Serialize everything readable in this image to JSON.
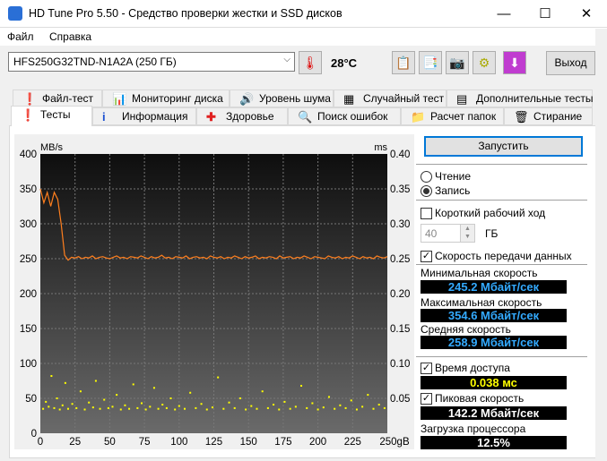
{
  "window": {
    "title": "HD Tune Pro 5.50 - Средство проверки жестки и SSD дисков",
    "minimize": "—",
    "maximize": "☐",
    "close": "✕"
  },
  "menu": [
    "Файл",
    "Справка"
  ],
  "toolbar": {
    "drive": "HFS250G32TND-N1A2A (250 ГБ)",
    "temperature": "28°C",
    "exit": "Выход"
  },
  "tabs_top": [
    {
      "label": "Файл-тест",
      "icon": "file-test-icon"
    },
    {
      "label": "Мониторинг диска",
      "icon": "monitor-icon"
    },
    {
      "label": "Уровень шума",
      "icon": "speaker-icon"
    },
    {
      "label": "Случайный тест",
      "icon": "random-icon"
    },
    {
      "label": "Дополнительные тесты",
      "icon": "extra-tests-icon"
    }
  ],
  "tabs_bottom": [
    {
      "label": "Тесты",
      "icon": "exclamation-icon",
      "active": true
    },
    {
      "label": "Информация",
      "icon": "info-icon"
    },
    {
      "label": "Здоровье",
      "icon": "health-cross-icon"
    },
    {
      "label": "Поиск ошибок",
      "icon": "magnifier-icon"
    },
    {
      "label": "Расчет папок",
      "icon": "folder-icon"
    },
    {
      "label": "Стирание",
      "icon": "trash-icon"
    }
  ],
  "side": {
    "start": "Запустить",
    "read": "Чтение",
    "write": "Запись",
    "mode": "write",
    "short_stroke": "Короткий рабочий ход",
    "short_stroke_checked": false,
    "stroke_value": "40",
    "stroke_unit": "ГБ",
    "transfer_rate": "Скорость передачи данных",
    "transfer_checked": true,
    "min_label": "Минимальная скорость",
    "min_value": "245.2 Мбайт/сек",
    "max_label": "Максимальная скорость",
    "max_value": "354.6 Мбайт/сек",
    "avg_label": "Средняя скорость",
    "avg_value": "258.9 Мбайт/сек",
    "access_label": "Время доступа",
    "access_checked": true,
    "access_value": "0.038 мс",
    "burst_label": "Пиковая скорость",
    "burst_checked": true,
    "burst_value": "142.2 Мбайт/сек",
    "cpu_label": "Загрузка процессора",
    "cpu_value": "12.5%",
    "colors": {
      "speed": "#33aaff",
      "access": "#ffff00",
      "white": "#ffffff"
    }
  },
  "chart_data": {
    "type": "line",
    "ylabel_left": "MB/s",
    "ylabel_right": "ms",
    "xunit": "gB",
    "ylim_left": [
      0,
      400
    ],
    "ylim_right": [
      0,
      0.4
    ],
    "xlim": [
      0,
      250
    ],
    "yticks_left": [
      "0",
      "50",
      "100",
      "150",
      "200",
      "250",
      "300",
      "350",
      "400"
    ],
    "yticks_right": [
      "0.05",
      "0.10",
      "0.15",
      "0.20",
      "0.25",
      "0.30",
      "0.35",
      "0.40"
    ],
    "xticks": [
      "0",
      "25",
      "50",
      "75",
      "100",
      "125",
      "150",
      "175",
      "200",
      "225",
      "250gB"
    ],
    "grid": true,
    "transfer": {
      "name": "Transfer rate",
      "color": "#ff7f1e",
      "step": 2.5,
      "values": [
        350,
        330,
        345,
        325,
        345,
        335,
        300,
        255,
        248,
        252,
        251,
        253,
        250,
        252,
        251,
        254,
        250,
        252,
        253,
        251,
        250,
        252,
        254,
        251,
        252,
        250,
        253,
        252,
        251,
        254,
        252,
        250,
        253,
        251,
        252,
        255,
        251,
        252,
        250,
        253,
        252,
        251,
        254,
        250,
        252,
        253,
        251,
        252,
        250,
        254,
        252,
        251,
        253,
        250,
        252,
        251,
        254,
        252,
        250,
        253,
        251,
        252,
        254,
        250,
        252,
        251,
        253,
        252,
        250,
        254,
        251,
        252,
        253,
        250,
        252,
        251,
        254,
        252,
        250,
        253,
        252,
        251,
        250,
        254,
        252,
        251,
        253,
        250,
        252,
        251,
        254,
        252,
        250,
        253,
        251,
        252,
        250,
        254,
        252,
        251,
        253
      ]
    },
    "access": {
      "name": "Access time (ms)",
      "color": "#ffff00",
      "points": [
        [
          2,
          0.035
        ],
        [
          4,
          0.045
        ],
        [
          6,
          0.038
        ],
        [
          8,
          0.082
        ],
        [
          10,
          0.036
        ],
        [
          12,
          0.05
        ],
        [
          14,
          0.034
        ],
        [
          16,
          0.04
        ],
        [
          18,
          0.072
        ],
        [
          20,
          0.035
        ],
        [
          23,
          0.042
        ],
        [
          26,
          0.036
        ],
        [
          29,
          0.06
        ],
        [
          32,
          0.034
        ],
        [
          35,
          0.044
        ],
        [
          38,
          0.037
        ],
        [
          40,
          0.075
        ],
        [
          43,
          0.035
        ],
        [
          46,
          0.048
        ],
        [
          49,
          0.036
        ],
        [
          52,
          0.038
        ],
        [
          55,
          0.055
        ],
        [
          58,
          0.034
        ],
        [
          61,
          0.04
        ],
        [
          64,
          0.035
        ],
        [
          67,
          0.07
        ],
        [
          70,
          0.036
        ],
        [
          73,
          0.043
        ],
        [
          76,
          0.034
        ],
        [
          79,
          0.038
        ],
        [
          82,
          0.065
        ],
        [
          85,
          0.035
        ],
        [
          88,
          0.041
        ],
        [
          91,
          0.036
        ],
        [
          94,
          0.05
        ],
        [
          97,
          0.034
        ],
        [
          100,
          0.039
        ],
        [
          104,
          0.035
        ],
        [
          108,
          0.058
        ],
        [
          112,
          0.036
        ],
        [
          116,
          0.042
        ],
        [
          120,
          0.034
        ],
        [
          124,
          0.037
        ],
        [
          128,
          0.08
        ],
        [
          132,
          0.035
        ],
        [
          136,
          0.044
        ],
        [
          140,
          0.036
        ],
        [
          144,
          0.05
        ],
        [
          148,
          0.034
        ],
        [
          152,
          0.039
        ],
        [
          156,
          0.035
        ],
        [
          160,
          0.06
        ],
        [
          164,
          0.036
        ],
        [
          168,
          0.041
        ],
        [
          172,
          0.034
        ],
        [
          176,
          0.045
        ],
        [
          180,
          0.035
        ],
        [
          184,
          0.038
        ],
        [
          188,
          0.068
        ],
        [
          192,
          0.036
        ],
        [
          196,
          0.043
        ],
        [
          200,
          0.034
        ],
        [
          204,
          0.037
        ],
        [
          208,
          0.052
        ],
        [
          212,
          0.035
        ],
        [
          216,
          0.04
        ],
        [
          220,
          0.036
        ],
        [
          224,
          0.047
        ],
        [
          228,
          0.034
        ],
        [
          232,
          0.038
        ],
        [
          236,
          0.055
        ],
        [
          240,
          0.035
        ],
        [
          244,
          0.041
        ],
        [
          248,
          0.036
        ]
      ]
    }
  }
}
